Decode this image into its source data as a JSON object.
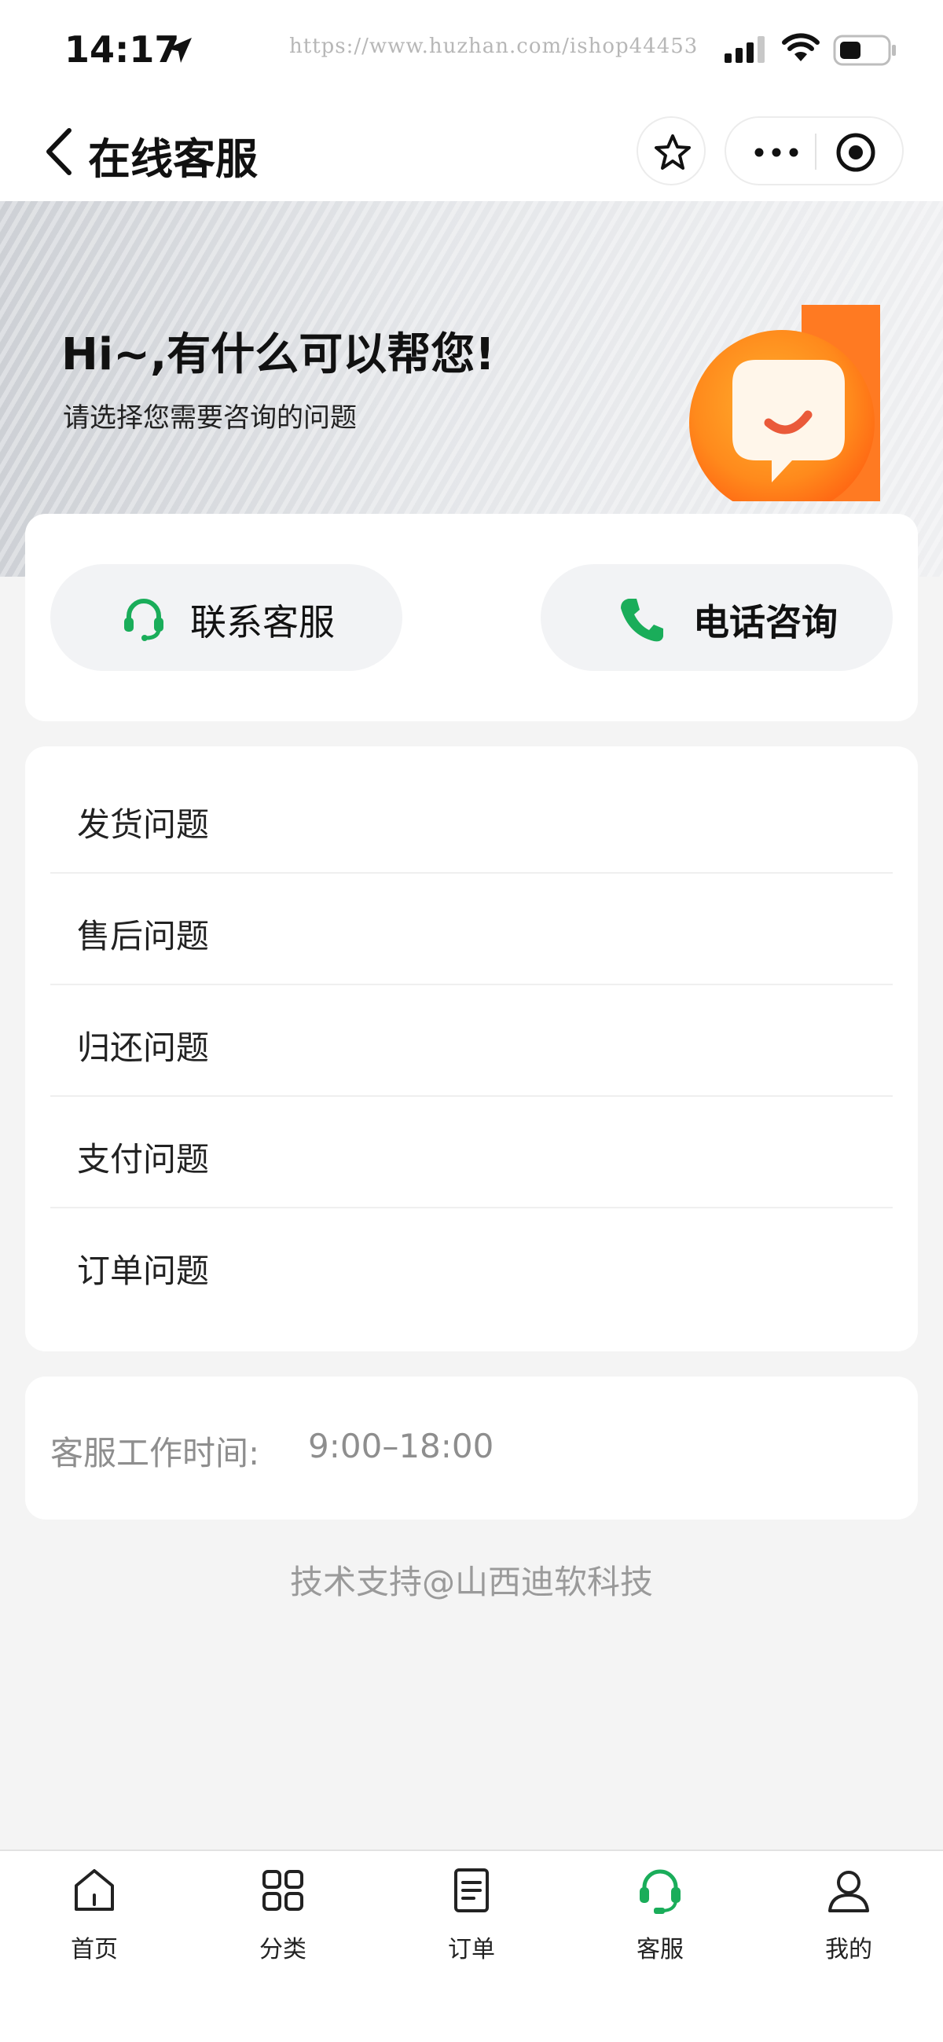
{
  "status_bar": {
    "time": "14:17",
    "watermark": "https://www.huzhan.com/ishop44453"
  },
  "nav": {
    "title": "在线客服"
  },
  "hero": {
    "title": "Hi~,有什么可以帮您!",
    "subtitle": "请选择您需要咨询的问题"
  },
  "contact": {
    "service_label": "联系客服",
    "phone_label": "电话咨询"
  },
  "topics": [
    {
      "label": "发货问题"
    },
    {
      "label": "售后问题"
    },
    {
      "label": "归还问题"
    },
    {
      "label": "支付问题"
    },
    {
      "label": "订单问题"
    }
  ],
  "hours": {
    "label": "客服工作时间:",
    "value": "9:00–18:00"
  },
  "support_text": "技术支持@山西迪软科技",
  "tabs": [
    {
      "label": "首页",
      "icon": "home-icon"
    },
    {
      "label": "分类",
      "icon": "grid-icon"
    },
    {
      "label": "订单",
      "icon": "order-icon"
    },
    {
      "label": "客服",
      "icon": "headset-icon"
    },
    {
      "label": "我的",
      "icon": "user-icon"
    }
  ],
  "colors": {
    "accent": "#1aad5a",
    "background": "#f4f4f4",
    "muted_text": "#8e8e8e"
  }
}
